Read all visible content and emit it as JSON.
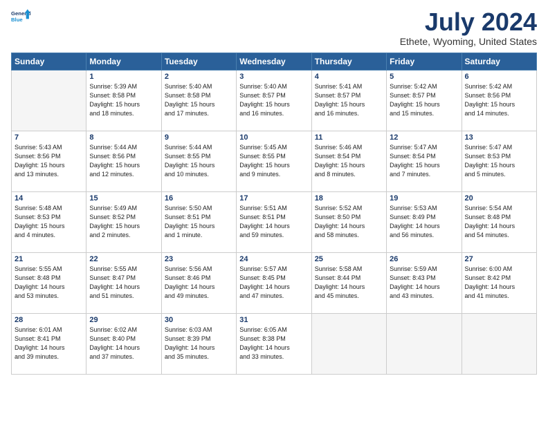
{
  "logo": {
    "line1": "General",
    "line2": "Blue"
  },
  "title": "July 2024",
  "subtitle": "Ethete, Wyoming, United States",
  "days_of_week": [
    "Sunday",
    "Monday",
    "Tuesday",
    "Wednesday",
    "Thursday",
    "Friday",
    "Saturday"
  ],
  "weeks": [
    [
      {
        "day": "",
        "info": ""
      },
      {
        "day": "1",
        "info": "Sunrise: 5:39 AM\nSunset: 8:58 PM\nDaylight: 15 hours\nand 18 minutes."
      },
      {
        "day": "2",
        "info": "Sunrise: 5:40 AM\nSunset: 8:58 PM\nDaylight: 15 hours\nand 17 minutes."
      },
      {
        "day": "3",
        "info": "Sunrise: 5:40 AM\nSunset: 8:57 PM\nDaylight: 15 hours\nand 16 minutes."
      },
      {
        "day": "4",
        "info": "Sunrise: 5:41 AM\nSunset: 8:57 PM\nDaylight: 15 hours\nand 16 minutes."
      },
      {
        "day": "5",
        "info": "Sunrise: 5:42 AM\nSunset: 8:57 PM\nDaylight: 15 hours\nand 15 minutes."
      },
      {
        "day": "6",
        "info": "Sunrise: 5:42 AM\nSunset: 8:56 PM\nDaylight: 15 hours\nand 14 minutes."
      }
    ],
    [
      {
        "day": "7",
        "info": "Sunrise: 5:43 AM\nSunset: 8:56 PM\nDaylight: 15 hours\nand 13 minutes."
      },
      {
        "day": "8",
        "info": "Sunrise: 5:44 AM\nSunset: 8:56 PM\nDaylight: 15 hours\nand 12 minutes."
      },
      {
        "day": "9",
        "info": "Sunrise: 5:44 AM\nSunset: 8:55 PM\nDaylight: 15 hours\nand 10 minutes."
      },
      {
        "day": "10",
        "info": "Sunrise: 5:45 AM\nSunset: 8:55 PM\nDaylight: 15 hours\nand 9 minutes."
      },
      {
        "day": "11",
        "info": "Sunrise: 5:46 AM\nSunset: 8:54 PM\nDaylight: 15 hours\nand 8 minutes."
      },
      {
        "day": "12",
        "info": "Sunrise: 5:47 AM\nSunset: 8:54 PM\nDaylight: 15 hours\nand 7 minutes."
      },
      {
        "day": "13",
        "info": "Sunrise: 5:47 AM\nSunset: 8:53 PM\nDaylight: 15 hours\nand 5 minutes."
      }
    ],
    [
      {
        "day": "14",
        "info": "Sunrise: 5:48 AM\nSunset: 8:53 PM\nDaylight: 15 hours\nand 4 minutes."
      },
      {
        "day": "15",
        "info": "Sunrise: 5:49 AM\nSunset: 8:52 PM\nDaylight: 15 hours\nand 2 minutes."
      },
      {
        "day": "16",
        "info": "Sunrise: 5:50 AM\nSunset: 8:51 PM\nDaylight: 15 hours\nand 1 minute."
      },
      {
        "day": "17",
        "info": "Sunrise: 5:51 AM\nSunset: 8:51 PM\nDaylight: 14 hours\nand 59 minutes."
      },
      {
        "day": "18",
        "info": "Sunrise: 5:52 AM\nSunset: 8:50 PM\nDaylight: 14 hours\nand 58 minutes."
      },
      {
        "day": "19",
        "info": "Sunrise: 5:53 AM\nSunset: 8:49 PM\nDaylight: 14 hours\nand 56 minutes."
      },
      {
        "day": "20",
        "info": "Sunrise: 5:54 AM\nSunset: 8:48 PM\nDaylight: 14 hours\nand 54 minutes."
      }
    ],
    [
      {
        "day": "21",
        "info": "Sunrise: 5:55 AM\nSunset: 8:48 PM\nDaylight: 14 hours\nand 53 minutes."
      },
      {
        "day": "22",
        "info": "Sunrise: 5:55 AM\nSunset: 8:47 PM\nDaylight: 14 hours\nand 51 minutes."
      },
      {
        "day": "23",
        "info": "Sunrise: 5:56 AM\nSunset: 8:46 PM\nDaylight: 14 hours\nand 49 minutes."
      },
      {
        "day": "24",
        "info": "Sunrise: 5:57 AM\nSunset: 8:45 PM\nDaylight: 14 hours\nand 47 minutes."
      },
      {
        "day": "25",
        "info": "Sunrise: 5:58 AM\nSunset: 8:44 PM\nDaylight: 14 hours\nand 45 minutes."
      },
      {
        "day": "26",
        "info": "Sunrise: 5:59 AM\nSunset: 8:43 PM\nDaylight: 14 hours\nand 43 minutes."
      },
      {
        "day": "27",
        "info": "Sunrise: 6:00 AM\nSunset: 8:42 PM\nDaylight: 14 hours\nand 41 minutes."
      }
    ],
    [
      {
        "day": "28",
        "info": "Sunrise: 6:01 AM\nSunset: 8:41 PM\nDaylight: 14 hours\nand 39 minutes."
      },
      {
        "day": "29",
        "info": "Sunrise: 6:02 AM\nSunset: 8:40 PM\nDaylight: 14 hours\nand 37 minutes."
      },
      {
        "day": "30",
        "info": "Sunrise: 6:03 AM\nSunset: 8:39 PM\nDaylight: 14 hours\nand 35 minutes."
      },
      {
        "day": "31",
        "info": "Sunrise: 6:05 AM\nSunset: 8:38 PM\nDaylight: 14 hours\nand 33 minutes."
      },
      {
        "day": "",
        "info": ""
      },
      {
        "day": "",
        "info": ""
      },
      {
        "day": "",
        "info": ""
      }
    ]
  ]
}
